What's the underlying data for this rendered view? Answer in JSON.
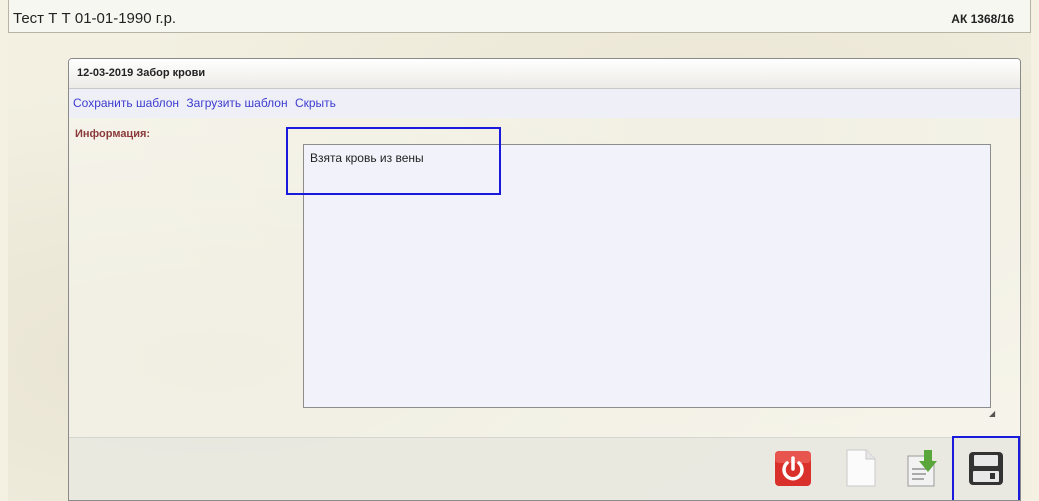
{
  "window": {
    "patient_name": "Тест Т Т 01-01-1990 г.р.",
    "case_number": "АК 1368/16"
  },
  "panel": {
    "title": "12-03-2019 Забор крови",
    "links": [
      "Сохранить шаблон",
      "Загрузить шаблон",
      "Скрыть"
    ],
    "info_label": "Информация:",
    "info_text": "Взята кровь из вены"
  },
  "toolbar": {
    "buttons": [
      {
        "name": "power-button",
        "icon": "power-icon",
        "color": "#d9302b"
      },
      {
        "name": "new-document-button",
        "icon": "blank-document-icon",
        "color": "#ffffff"
      },
      {
        "name": "import-button",
        "icon": "document-download-icon",
        "color": "#5aa63a"
      },
      {
        "name": "save-button",
        "icon": "floppy-disk-icon",
        "color": "#333333"
      }
    ]
  },
  "colors": {
    "link": "#3c3ccf",
    "label": "#8b3a3a",
    "highlight": "#1a1adc"
  }
}
